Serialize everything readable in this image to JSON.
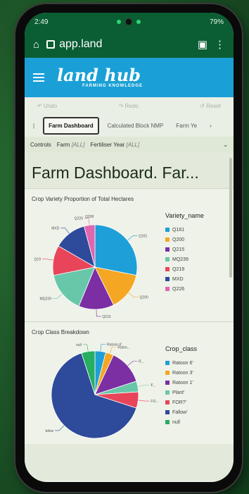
{
  "status": {
    "time": "2:49",
    "battery": "79%"
  },
  "browser": {
    "url": "app.land"
  },
  "brand": {
    "logo_main": "land hub",
    "logo_sub": "FARMING KNOWLEDGE"
  },
  "toolbar": {
    "undo": "Undo",
    "redo": "Redo",
    "reset": "Reset"
  },
  "tabs": [
    "Farm Dashboard",
    "Calculated Block NMP",
    "Farm Ye"
  ],
  "controls": {
    "label": "Controls",
    "farm_label": "Farm",
    "farm_value": "[ALL]",
    "fert_label": "Fertiliser Year",
    "fert_value": "[ALL]"
  },
  "page": {
    "title": "Farm Dashboard. Far..."
  },
  "chart_data": [
    {
      "type": "pie",
      "title": "Crop Variety Proportion of Total Hectares",
      "legend_title": "Variety_name",
      "categories": [
        "Q161",
        "Q200",
        "Q215",
        "MQ239",
        "Q219",
        "MXD",
        "Q226"
      ],
      "values": [
        27,
        14,
        13,
        15,
        11,
        12,
        4
      ],
      "colors": [
        "#1e9fd8",
        "#f5a623",
        "#7b2fa3",
        "#69c7a9",
        "#e8455a",
        "#2e4a9b",
        "#e066b0"
      ],
      "slice_labels": [
        "Q161",
        "Q200",
        "Q215",
        "MQ239",
        "Q19",
        "MXD",
        "Q226"
      ],
      "extra_label": "Q208"
    },
    {
      "type": "pie",
      "title": "Crop Class Breakdown",
      "legend_title": "Crop_class",
      "categories": [
        "Ratoon 6'",
        "Ratoon 3'",
        "Ratoon 1'",
        "Plant'",
        "FOR?'",
        "Fallow'",
        "null"
      ],
      "values": [
        4,
        3,
        13,
        4,
        6,
        65,
        5
      ],
      "colors": [
        "#1e9fd8",
        "#f5a623",
        "#7b2fa3",
        "#69c7a9",
        "#e8455a",
        "#2e4a9b",
        "#27ae60"
      ],
      "slice_labels": [
        "Ratoon 6'",
        "Ratoo...",
        "R...",
        "'F...",
        "FO...",
        "'allow",
        "null"
      ]
    }
  ]
}
